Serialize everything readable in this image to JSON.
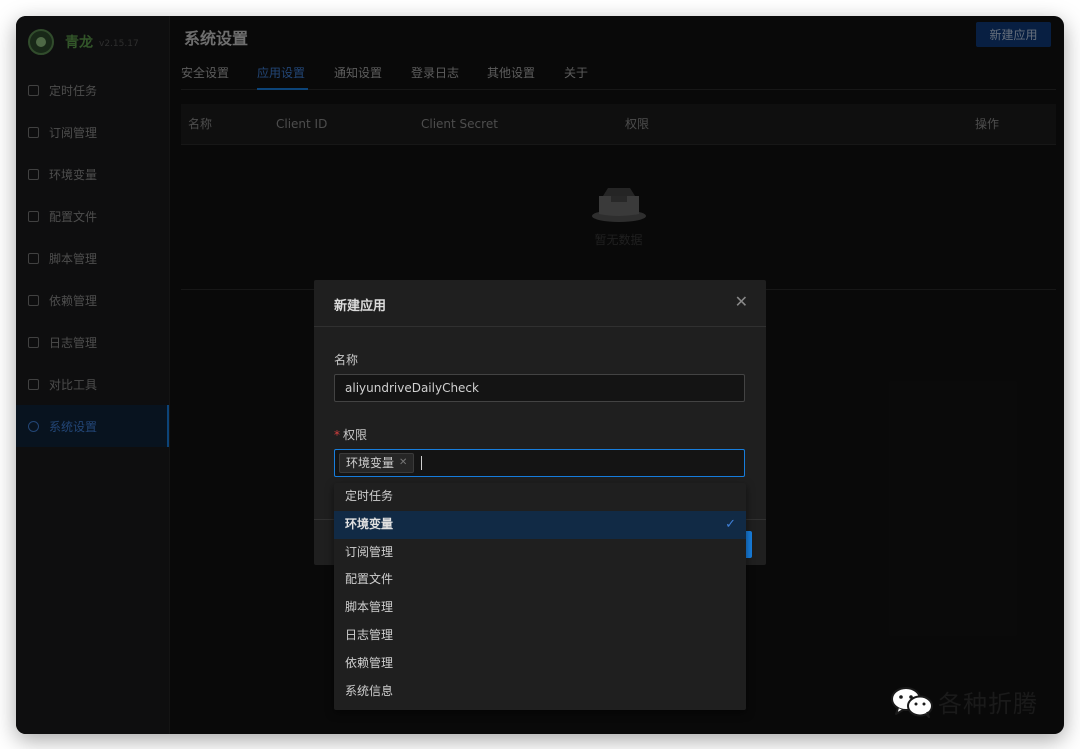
{
  "app": {
    "name": "青龙",
    "version": "v2.15.17"
  },
  "sidebar": {
    "items": [
      {
        "label": "定时任务",
        "icon": "clock-icon"
      },
      {
        "label": "订阅管理",
        "icon": "subscription-icon"
      },
      {
        "label": "环境变量",
        "icon": "monitor-icon"
      },
      {
        "label": "配置文件",
        "icon": "sliders-icon"
      },
      {
        "label": "脚本管理",
        "icon": "code-icon"
      },
      {
        "label": "依赖管理",
        "icon": "package-icon"
      },
      {
        "label": "日志管理",
        "icon": "log-icon"
      },
      {
        "label": "对比工具",
        "icon": "diff-icon"
      },
      {
        "label": "系统设置",
        "icon": "settings-icon",
        "active": true
      }
    ]
  },
  "header": {
    "title": "系统设置",
    "create_button": "新建应用"
  },
  "tabs": [
    "安全设置",
    "应用设置",
    "通知设置",
    "登录日志",
    "其他设置",
    "关于"
  ],
  "active_tab": "应用设置",
  "table": {
    "columns": [
      "名称",
      "Client ID",
      "Client Secret",
      "权限",
      "操作"
    ],
    "empty_text": "暂无数据"
  },
  "modal": {
    "title": "新建应用",
    "name_label": "名称",
    "name_value": "aliyundriveDailyCheck",
    "scope_label": "权限",
    "required_mark": "*",
    "selected_tags": [
      "环境变量"
    ]
  },
  "dropdown": {
    "options": [
      "定时任务",
      "环境变量",
      "订阅管理",
      "配置文件",
      "脚本管理",
      "日志管理",
      "依赖管理",
      "系统信息"
    ],
    "selected": "环境变量"
  },
  "watermark": {
    "text": "各种折腾"
  },
  "colors": {
    "accent": "#177ddc",
    "background": "#121212",
    "sidebar": "#1b1b1c",
    "brand_green": "#5c9c4c",
    "required": "#d33e3e"
  }
}
